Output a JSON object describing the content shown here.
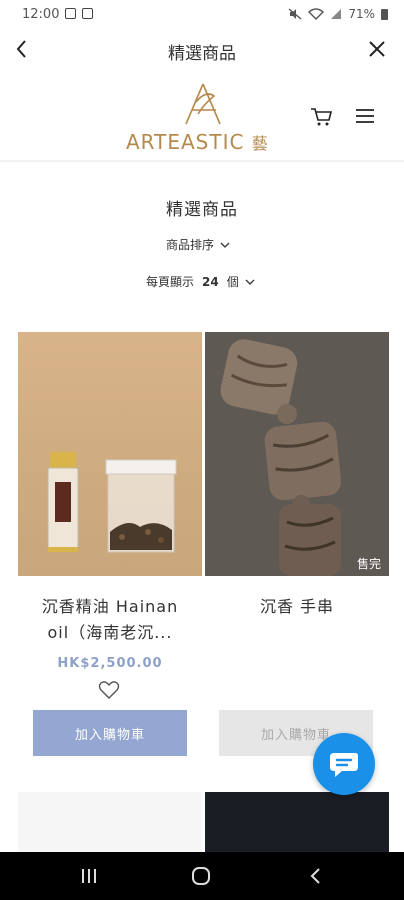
{
  "status_bar": {
    "time": "12:00",
    "battery": "71%"
  },
  "webview": {
    "title": "精選商品"
  },
  "site": {
    "logo_text": "ARTEASTIC",
    "logo_suffix": "藝"
  },
  "listing": {
    "title": "精選商品",
    "sort_label": "商品排序",
    "per_page_prefix": "每頁顯示",
    "per_page_value": "24",
    "per_page_suffix": "個"
  },
  "products": [
    {
      "name_line1": "沉香精油 Hainan",
      "name_line2": "oil（海南老沉...",
      "price": "HK$2,500.00",
      "button": "加入購物車",
      "sold_out": false
    },
    {
      "name_line1": "沉香 手串",
      "name_line2": "",
      "price": "",
      "button": "加入購物車",
      "badge": "售完",
      "sold_out": true
    }
  ],
  "colors": {
    "accent": "#94a6d2",
    "price": "#8ea1c9",
    "logo": "#b5894d",
    "chat": "#1a90e8"
  }
}
